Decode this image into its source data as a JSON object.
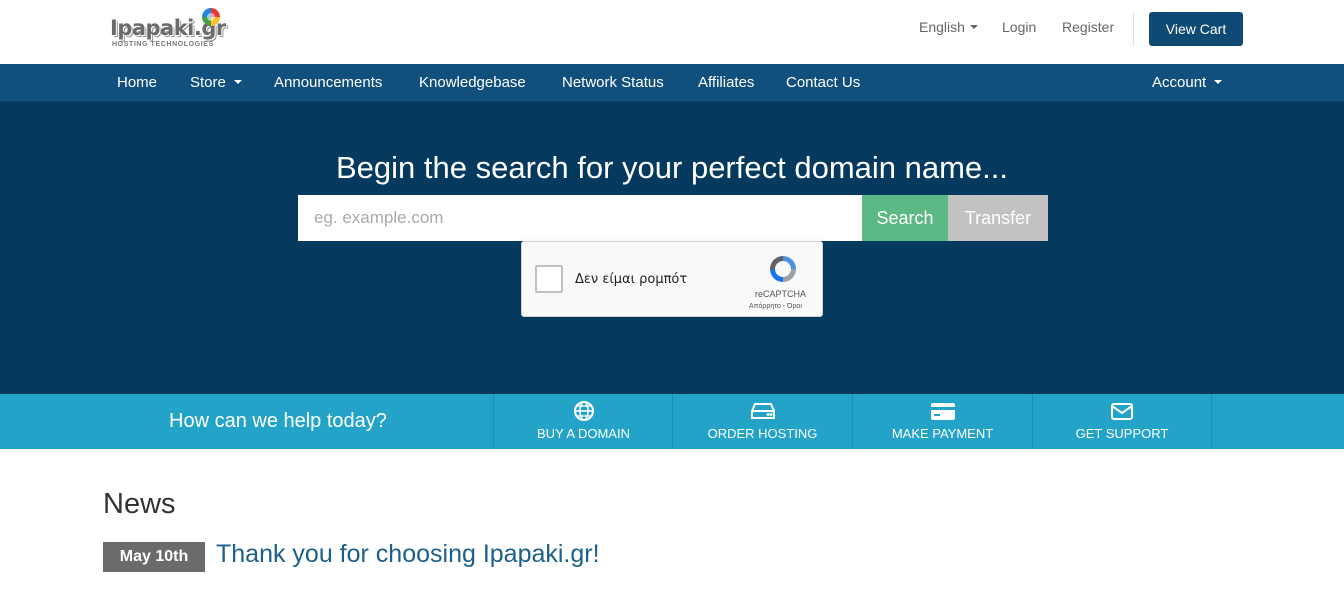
{
  "header": {
    "logo_text": "Ipapaki.gr",
    "logo_sub": "HOSTING TECHNOLOGIES",
    "language": "English",
    "login": "Login",
    "register": "Register",
    "view_cart": "View Cart"
  },
  "nav": {
    "items": [
      "Home",
      "Store",
      "Announcements",
      "Knowledgebase",
      "Network Status",
      "Affiliates",
      "Contact Us"
    ],
    "account": "Account"
  },
  "hero": {
    "title": "Begin the search for your perfect domain name...",
    "search_placeholder": "eg. example.com",
    "search_button": "Search",
    "transfer_button": "Transfer",
    "captcha_label": "Δεν είμαι ρομπότ",
    "captcha_brand": "reCAPTCHA",
    "captcha_terms": "Απόρρητο - Όροι"
  },
  "help": {
    "prompt": "How can we help today?",
    "items": [
      {
        "label": "BUY A DOMAIN",
        "icon": "globe-icon"
      },
      {
        "label": "ORDER HOSTING",
        "icon": "server-icon"
      },
      {
        "label": "MAKE PAYMENT",
        "icon": "credit-card-icon"
      },
      {
        "label": "GET SUPPORT",
        "icon": "envelope-icon"
      }
    ]
  },
  "news": {
    "title": "News",
    "items": [
      {
        "date": "May 10th",
        "title": "Thank you for choosing Ipapaki.gr!"
      }
    ]
  },
  "colors": {
    "nav_bg": "#11507d",
    "hero_bg": "#053a5e",
    "search_button": "#5cb885",
    "transfer_button": "#c2c2c2",
    "help_bar": "#23a3c8",
    "cart_button": "#0e4a74",
    "news_link": "#1b5f8c"
  }
}
